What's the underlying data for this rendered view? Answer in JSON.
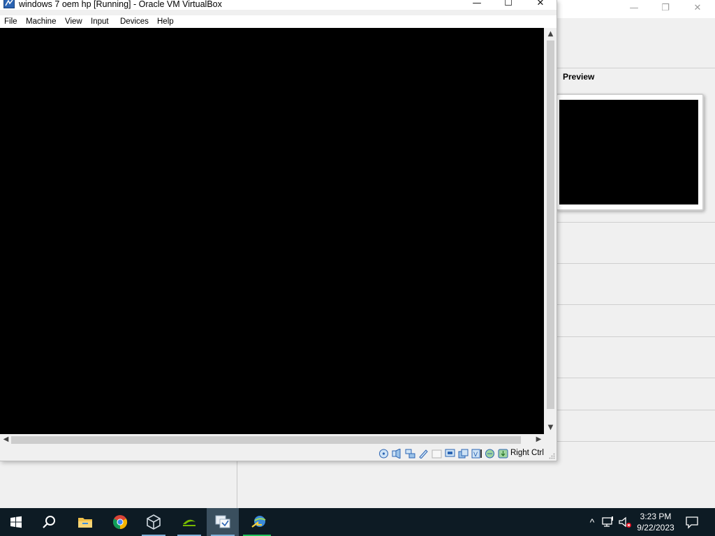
{
  "background_window": {
    "preview_label": "Preview"
  },
  "vm_window": {
    "title": "windows 7 oem hp [Running] - Oracle VM VirtualBox",
    "controls": {
      "minimize": "—",
      "maximize": "☐",
      "close": "✕"
    },
    "menu": [
      "File",
      "Machine",
      "View",
      "Input",
      "Devices",
      "Help"
    ],
    "scroll": {
      "up": "▲",
      "down": "▼",
      "left": "◀",
      "right": "▶"
    },
    "statusbar": {
      "icons": [
        "optical-drive-icon",
        "audio-icon",
        "network-icon",
        "usb-icon",
        "shared-folders-icon",
        "display-icon",
        "recording-icon",
        "cpu-icon",
        "vt-x-icon",
        "mouse-integration-icon",
        "keyboard-capture-icon"
      ],
      "host_key": "Right Ctrl"
    }
  },
  "taskbar": {
    "apps": [
      "start-button",
      "search-button",
      "file-explorer",
      "chrome",
      "virtualbox",
      "nvidia",
      "vmware-workstation",
      "internet-download-manager"
    ],
    "tray": {
      "chevron": "^",
      "time": "3:23 PM",
      "date": "9/22/2023"
    }
  }
}
